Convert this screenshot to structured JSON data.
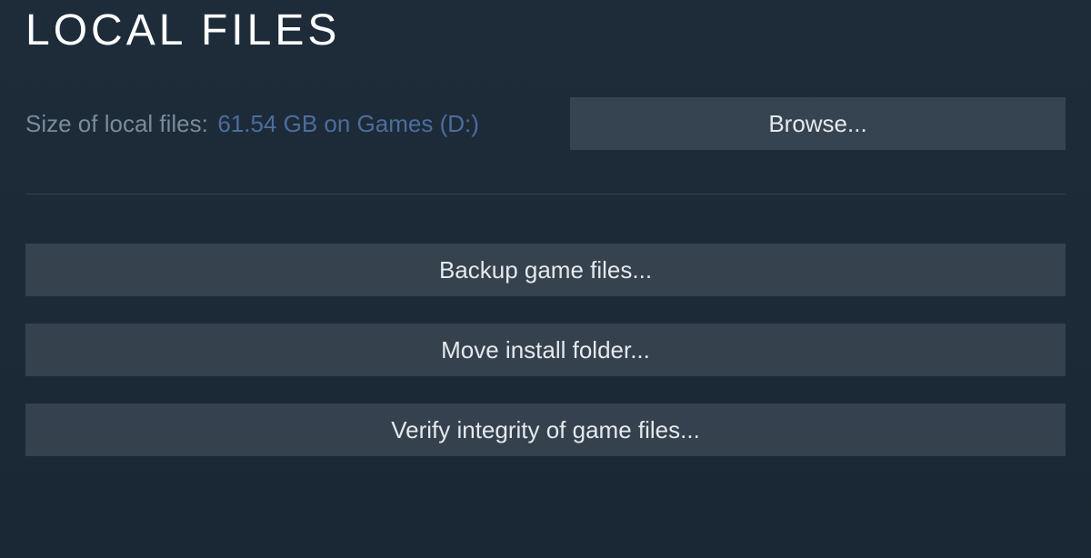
{
  "header": {
    "title": "LOCAL FILES"
  },
  "size": {
    "label": "Size of local files:",
    "value": "61.54 GB on Games (D:)"
  },
  "buttons": {
    "browse": "Browse...",
    "backup": "Backup game files...",
    "move": "Move install folder...",
    "verify": "Verify integrity of game files..."
  }
}
